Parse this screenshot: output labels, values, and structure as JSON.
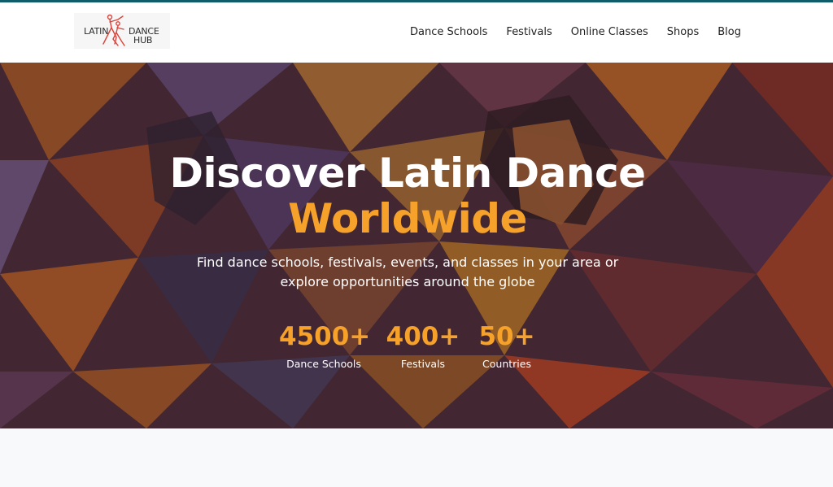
{
  "logo": {
    "line1": "LATIN",
    "line2": "DANCE",
    "line3": "HUB"
  },
  "nav": [
    {
      "label": "Dance Schools"
    },
    {
      "label": "Festivals"
    },
    {
      "label": "Online Classes"
    },
    {
      "label": "Shops"
    },
    {
      "label": "Blog"
    }
  ],
  "hero": {
    "title_line1": "Discover Latin Dance",
    "title_line2": "Worldwide",
    "subtitle": "Find dance schools, festivals, events, and classes in your area or explore opportunities around the globe"
  },
  "stats": [
    {
      "value": "4500+",
      "label": "Dance Schools"
    },
    {
      "value": "400+",
      "label": "Festivals"
    },
    {
      "value": "50+",
      "label": "Countries"
    }
  ],
  "colors": {
    "top_bar": "#0f5c6b",
    "accent": "#f5a12a",
    "logo_dancers": "#d9433a"
  }
}
